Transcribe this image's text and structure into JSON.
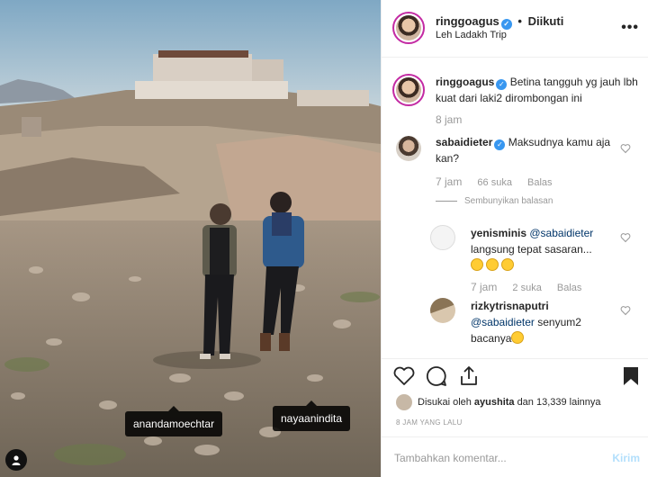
{
  "post": {
    "username": "ringgoagus",
    "follow_status": "Diikuti",
    "location": "Leh Ladakh Trip",
    "more_label": "•••"
  },
  "photo": {
    "tags": [
      "anandamoechtar",
      "nayaanindita"
    ]
  },
  "comments": [
    {
      "username": "ringgoagus",
      "text": "Betina tangguh yg jauh lbh kuat dari laki2 dirombongan ini",
      "time": "8 jam"
    },
    {
      "username": "sabaidieter",
      "text": "Maksudnya kamu aja kan?",
      "time": "7 jam",
      "likes": "66 suka",
      "reply_label": "Balas"
    }
  ],
  "hide_replies_label": "Sembunyikan balasan",
  "replies": [
    {
      "username": "yenisminis",
      "mention": "@sabaidieter",
      "text": "langsung tepat sasaran...",
      "emoji": [
        "smile-emoji",
        "smile-emoji",
        "smile-emoji"
      ],
      "time": "7 jam",
      "likes": "2 suka",
      "reply_label": "Balas"
    },
    {
      "username": "rizkytrisnaputri",
      "mention": "@sabaidieter",
      "text": "senyum2 bacanya",
      "emoji": [
        "smile-emoji"
      ]
    }
  ],
  "likes_line": {
    "prefix": "Disukai oleh",
    "user": "ayushita",
    "suffix": "dan 13,339 lainnya"
  },
  "timestamp": "8 JAM YANG LALU",
  "comment_box": {
    "placeholder": "Tambahkan komentar...",
    "post_label": "Kirim"
  },
  "colors": {
    "verified": "#3897f0",
    "mention": "#003569",
    "post_disabled": "#b2dffc"
  }
}
